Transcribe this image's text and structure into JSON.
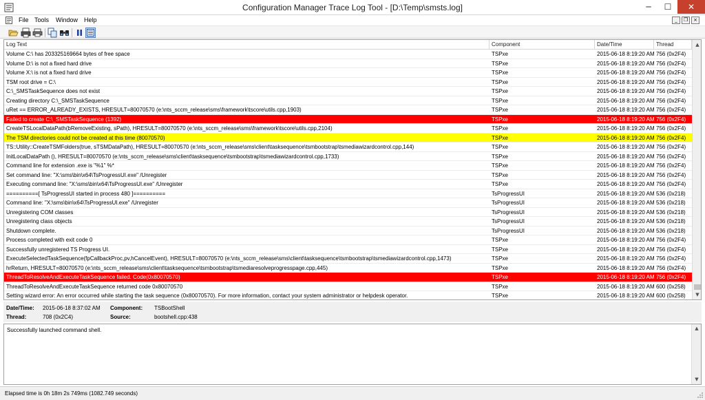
{
  "window": {
    "title": "Configuration Manager Trace Log Tool - [D:\\Temp\\smsts.log]",
    "minimize": "─",
    "maximize": "☐",
    "close": "✕"
  },
  "menu": {
    "items": [
      "File",
      "Tools",
      "Window",
      "Help"
    ],
    "mdi_minimize": "_",
    "mdi_restore": "❒",
    "mdi_close": "×"
  },
  "toolbar": {
    "buttons": [
      "open-icon",
      "print-setup-icon",
      "print-icon",
      "copy-icon",
      "find-icon",
      "pause-icon",
      "highlight-icon"
    ]
  },
  "grid": {
    "columns": [
      "Log Text",
      "Component",
      "Date/Time",
      "Thread"
    ],
    "rows": [
      {
        "text": "Volume C:\\ has 203325169664 bytes of free space",
        "component": "TSPxe",
        "datetime": "2015-06-18 8:19:20 AM",
        "thread": "756 (0x2F4)",
        "level": "info"
      },
      {
        "text": "Volume D:\\ is not a fixed hard drive",
        "component": "TSPxe",
        "datetime": "2015-06-18 8:19:20 AM",
        "thread": "756 (0x2F4)",
        "level": "info"
      },
      {
        "text": "Volume X:\\ is not a fixed hard drive",
        "component": "TSPxe",
        "datetime": "2015-06-18 8:19:20 AM",
        "thread": "756 (0x2F4)",
        "level": "info"
      },
      {
        "text": "TSM root drive = C:\\",
        "component": "TSPxe",
        "datetime": "2015-06-18 8:19:20 AM",
        "thread": "756 (0x2F4)",
        "level": "info"
      },
      {
        "text": "C:\\_SMSTaskSequence does not exist",
        "component": "TSPxe",
        "datetime": "2015-06-18 8:19:20 AM",
        "thread": "756 (0x2F4)",
        "level": "info"
      },
      {
        "text": "Creating directory C:\\_SMSTaskSequence",
        "component": "TSPxe",
        "datetime": "2015-06-18 8:19:20 AM",
        "thread": "756 (0x2F4)",
        "level": "info"
      },
      {
        "text": "uRet == ERROR_ALREADY_EXISTS, HRESULT=80070570 (e:\\nts_sccm_release\\sms\\framework\\tscore\\utils.cpp,1903)",
        "component": "TSPxe",
        "datetime": "2015-06-18 8:19:20 AM",
        "thread": "756 (0x2F4)",
        "level": "info"
      },
      {
        "text": "Failed to create C:\\_SMSTaskSequence (1392)",
        "component": "TSPxe",
        "datetime": "2015-06-18 8:19:20 AM",
        "thread": "756 (0x2F4)",
        "level": "error"
      },
      {
        "text": "CreateTSLocalDataPath(bRemoveExisting, sPath), HRESULT=80070570 (e:\\nts_sccm_release\\sms\\framework\\tscore\\utils.cpp,2104)",
        "component": "TSPxe",
        "datetime": "2015-06-18 8:19:20 AM",
        "thread": "756 (0x2F4)",
        "level": "info"
      },
      {
        "text": "The TSM directories could not be created at this time (80070570)",
        "component": "TSPxe",
        "datetime": "2015-06-18 8:19:20 AM",
        "thread": "756 (0x2F4)",
        "level": "warning"
      },
      {
        "text": "TS::Utility::CreateTSMFolders(true, sTSMDataPath), HRESULT=80070570 (e:\\nts_sccm_release\\sms\\client\\tasksequence\\tsmbootstrap\\tsmediawizardcontrol.cpp,144)",
        "component": "TSPxe",
        "datetime": "2015-06-18 8:19:20 AM",
        "thread": "756 (0x2F4)",
        "level": "info"
      },
      {
        "text": "InitLocalDataPath (), HRESULT=80070570 (e:\\nts_sccm_release\\sms\\client\\tasksequence\\tsmbootstrap\\tsmediawizardcontrol.cpp,1733)",
        "component": "TSPxe",
        "datetime": "2015-06-18 8:19:20 AM",
        "thread": "756 (0x2F4)",
        "level": "info"
      },
      {
        "text": "Command line for extension .exe is \"%1\" %*",
        "component": "TSPxe",
        "datetime": "2015-06-18 8:19:20 AM",
        "thread": "756 (0x2F4)",
        "level": "info"
      },
      {
        "text": "Set command line: \"X:\\sms\\bin\\x64\\TsProgressUI.exe\" /Unregister",
        "component": "TSPxe",
        "datetime": "2015-06-18 8:19:20 AM",
        "thread": "756 (0x2F4)",
        "level": "info"
      },
      {
        "text": "Executing command line: \"X:\\sms\\bin\\x64\\TsProgressUI.exe\" /Unregister",
        "component": "TSPxe",
        "datetime": "2015-06-18 8:19:20 AM",
        "thread": "756 (0x2F4)",
        "level": "info"
      },
      {
        "text": "==========[ TsProgressUI started in process 480 ]==========",
        "component": "TsProgressUI",
        "datetime": "2015-06-18 8:19:20 AM",
        "thread": "536 (0x218)",
        "level": "info"
      },
      {
        "text": "Command line: \"X:\\sms\\bin\\x64\\TsProgressUI.exe\" /Unregister",
        "component": "TsProgressUI",
        "datetime": "2015-06-18 8:19:20 AM",
        "thread": "536 (0x218)",
        "level": "info"
      },
      {
        "text": "Unregistering COM classes",
        "component": "TsProgressUI",
        "datetime": "2015-06-18 8:19:20 AM",
        "thread": "536 (0x218)",
        "level": "info"
      },
      {
        "text": "Unregistering class objects",
        "component": "TsProgressUI",
        "datetime": "2015-06-18 8:19:20 AM",
        "thread": "536 (0x218)",
        "level": "info"
      },
      {
        "text": "Shutdown complete.",
        "component": "TsProgressUI",
        "datetime": "2015-06-18 8:19:20 AM",
        "thread": "536 (0x218)",
        "level": "info"
      },
      {
        "text": "Process completed with exit code 0",
        "component": "TSPxe",
        "datetime": "2015-06-18 8:19:20 AM",
        "thread": "756 (0x2F4)",
        "level": "info"
      },
      {
        "text": "Successfully unregistered TS Progress UI.",
        "component": "TSPxe",
        "datetime": "2015-06-18 8:19:20 AM",
        "thread": "756 (0x2F4)",
        "level": "info"
      },
      {
        "text": "ExecuteSelectedTaskSequence(fpCallbackProc,pv,hCancelEvent), HRESULT=80070570 (e:\\nts_sccm_release\\sms\\client\\tasksequence\\tsmbootstrap\\tsmediawizardcontrol.cpp,1473)",
        "component": "TSPxe",
        "datetime": "2015-06-18 8:19:20 AM",
        "thread": "756 (0x2F4)",
        "level": "info"
      },
      {
        "text": "hrReturn, HRESULT=80070570 (e:\\nts_sccm_release\\sms\\client\\tasksequence\\tsmbootstrap\\tsmediaresolveprogresspage.cpp,445)",
        "component": "TSPxe",
        "datetime": "2015-06-18 8:19:20 AM",
        "thread": "756 (0x2F4)",
        "level": "info"
      },
      {
        "text": "ThreadToResolveAndExecuteTaskSequence failed. Code(0x80070570)",
        "component": "TSPxe",
        "datetime": "2015-06-18 8:19:20 AM",
        "thread": "756 (0x2F4)",
        "level": "error"
      },
      {
        "text": "ThreadToResolveAndExecuteTaskSequence returned code 0x80070570",
        "component": "TSPxe",
        "datetime": "2015-06-18 8:19:20 AM",
        "thread": "600 (0x258)",
        "level": "info"
      },
      {
        "text": "Setting wizard error: An error occurred while starting the task sequence (0x80070570). For more information, contact your system administrator or helpdesk operator.",
        "component": "TSPxe",
        "datetime": "2015-06-18 8:19:20 AM",
        "thread": "600 (0x258)",
        "level": "info"
      }
    ]
  },
  "details": {
    "datetime_label": "Date/Time:",
    "datetime_value": "2015-06-18 8:37:02 AM",
    "component_label": "Component:",
    "component_value": "TSBootShell",
    "thread_label": "Thread:",
    "thread_value": "708 (0x2C4)",
    "source_label": "Source:",
    "source_value": "bootshell.cpp:438"
  },
  "message": "Successfully launched command shell.",
  "status": "Elapsed time is 0h 18m 2s 749ms (1082.749 seconds)",
  "colors": {
    "error": "#ff0000",
    "warning": "#ffff00",
    "close": "#c7402e"
  }
}
